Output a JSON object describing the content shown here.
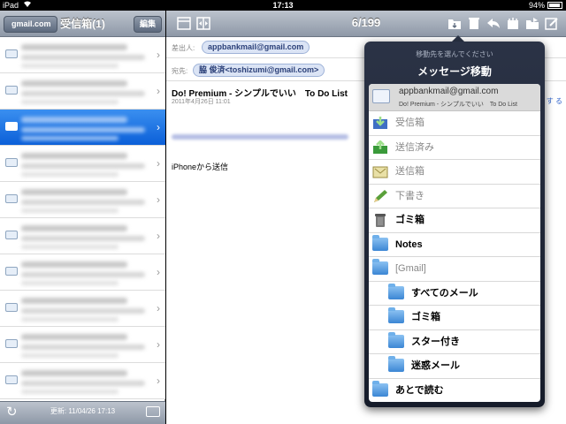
{
  "status": {
    "carrier": "iPad",
    "time": "17:13",
    "battery": "94%"
  },
  "left_pane": {
    "back_label": "gmail.com",
    "title": "受信箱(1)",
    "edit_label": "編集",
    "updated": "更新: 11/04/26 17:13",
    "selected_row_index": 2
  },
  "detail": {
    "counter": "6/199",
    "from_label": "差出人:",
    "from_value": "appbankmail@gmail.com",
    "to_label": "宛先:",
    "to_value": "脇 俊済<toshizumi@gmail.com>",
    "subject": "Do! Premium - シンプルでいい　To Do List",
    "date": "2011年4月26日 11:01",
    "body": "iPhoneから送信",
    "peek_link": "す る"
  },
  "popover": {
    "prompt": "移動先を選んでください",
    "title": "メッセージ移動",
    "message": {
      "from": "appbankmail@gmail.com",
      "subject": "Do! Premium - シンプルでいい　To Do List"
    },
    "folders": [
      {
        "label": "受信箱",
        "icon": "inbox-icon",
        "style": "dim",
        "indent": 0
      },
      {
        "label": "送信済み",
        "icon": "sent-icon",
        "style": "dim",
        "indent": 0
      },
      {
        "label": "送信箱",
        "icon": "outbox-icon",
        "style": "dim",
        "indent": 0
      },
      {
        "label": "下書き",
        "icon": "draft-pencil-icon",
        "style": "dim",
        "indent": 0
      },
      {
        "label": "ゴミ箱",
        "icon": "trash-icon",
        "style": "bold",
        "indent": 0
      },
      {
        "label": "Notes",
        "icon": "folder-icon",
        "style": "bold",
        "indent": 0
      },
      {
        "label": "[Gmail]",
        "icon": "folder-icon",
        "style": "dim",
        "indent": 0
      },
      {
        "label": "すべてのメール",
        "icon": "folder-icon",
        "style": "bold",
        "indent": 1
      },
      {
        "label": "ゴミ箱",
        "icon": "folder-icon",
        "style": "bold",
        "indent": 1
      },
      {
        "label": "スター付き",
        "icon": "folder-icon",
        "style": "bold",
        "indent": 1
      },
      {
        "label": "迷惑メール",
        "icon": "folder-icon",
        "style": "bold",
        "indent": 1
      },
      {
        "label": "あとで読む",
        "icon": "folder-icon",
        "style": "bold",
        "indent": 0
      }
    ]
  },
  "colors": {
    "accent": "#0b5fd8",
    "navbar": "#8e98a7",
    "popover": "#1f2637"
  }
}
